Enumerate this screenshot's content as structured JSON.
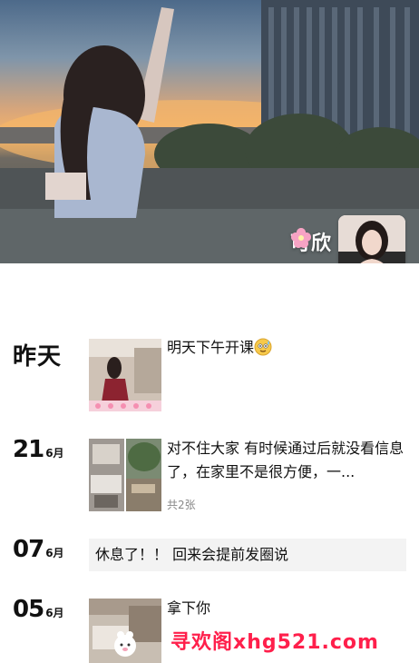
{
  "profile": {
    "nickname": "可欣",
    "nickname_decoration_icon": "pink-flower-icon"
  },
  "posts": [
    {
      "date_word": "昨天",
      "text": "明天下午开课",
      "text_emoji": "sweat-smile-emoji",
      "image_count_label": ""
    },
    {
      "day": "21",
      "month": "6月",
      "text": "对不住大家 有时候通过后就没看信息了，在家里不是很方便，一...",
      "image_count_label": "共2张"
    },
    {
      "day": "07",
      "month": "6月",
      "text": "休息了！！ 回来会提前发圈说",
      "image_count_label": ""
    },
    {
      "day": "05",
      "month": "6月",
      "text": "拿下你",
      "image_count_label": ""
    }
  ],
  "watermark": "寻欢阁xhg521.com",
  "colors": {
    "watermark": "#ff1f4b",
    "text_box_bg": "#f3f3f3",
    "count_gray": "#888888"
  }
}
